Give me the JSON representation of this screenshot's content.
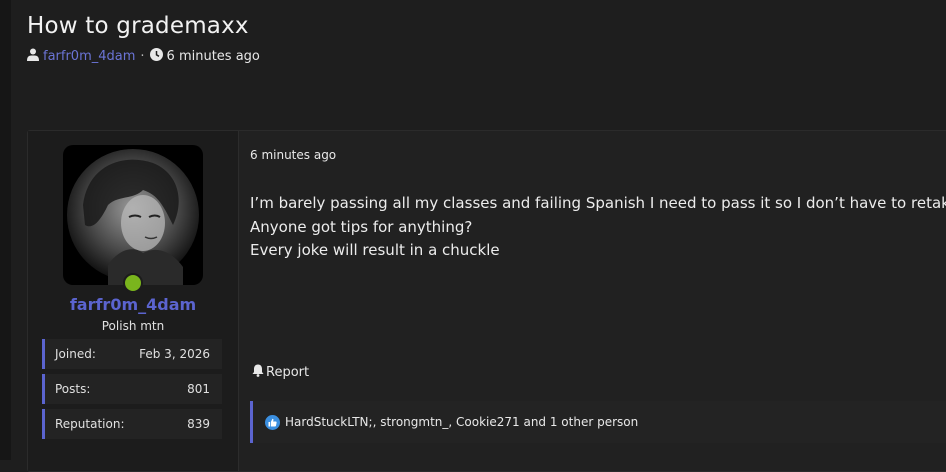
{
  "thread": {
    "title": "How to grademaxx",
    "author": "farfr0m_4dam",
    "separator": "·",
    "time": "6 minutes ago"
  },
  "user": {
    "name": "farfr0m_4dam",
    "user_title": "Polish mtn",
    "online": true,
    "online_color": "#7ab51d",
    "stats": [
      {
        "label": "Joined:",
        "value": "Feb 3, 2026"
      },
      {
        "label": "Posts:",
        "value": "801"
      },
      {
        "label": "Reputation:",
        "value": "839"
      }
    ]
  },
  "post": {
    "time": "6 minutes ago",
    "lines": [
      "I’m barely passing all my classes and failing Spanish I need to pass it so I don’t have to retake it",
      "Anyone got tips for anything?",
      "Every joke will result in a chuckle"
    ],
    "report_label": "Report",
    "reactions_text": "HardStuckLTN;, strongmtn_, Cookie271 and 1 other person"
  },
  "icons": {
    "user": "user-icon",
    "clock": "clock-icon",
    "bell": "bell-icon",
    "like": "thumbs-up-icon"
  },
  "colors": {
    "accent": "#5b64cf",
    "link": "#6b74d6",
    "like": "#3b8fe0"
  }
}
